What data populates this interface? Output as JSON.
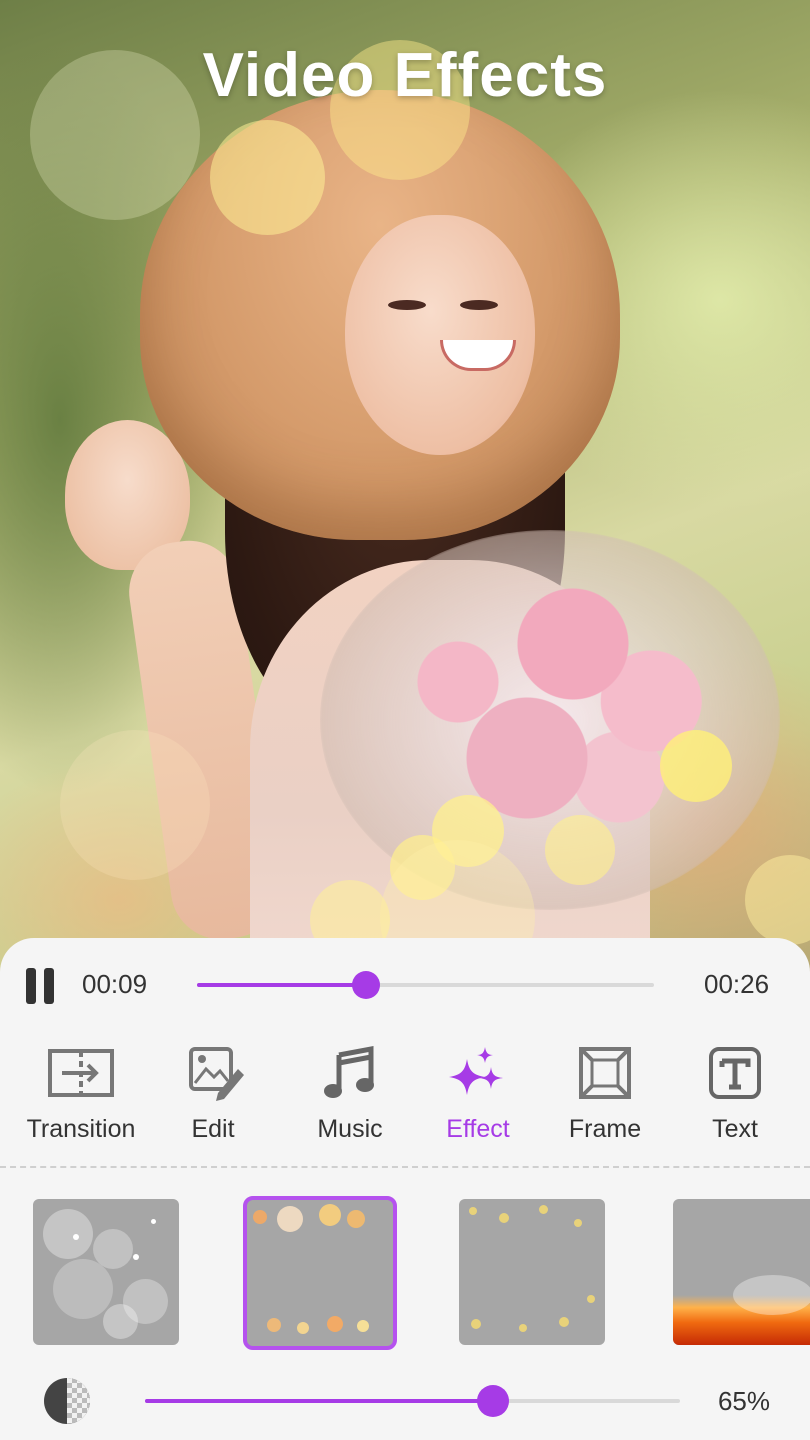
{
  "header": {
    "title": "Video Effects"
  },
  "player": {
    "current_time": "00:09",
    "total_time": "00:26",
    "progress": 0.37
  },
  "tools": [
    {
      "label": "Transition",
      "icon": "transition-icon",
      "active": false
    },
    {
      "label": "Edit",
      "icon": "edit-image-icon",
      "active": false
    },
    {
      "label": "Music",
      "icon": "music-note-icon",
      "active": false
    },
    {
      "label": "Effect",
      "icon": "sparkles-icon",
      "active": true
    },
    {
      "label": "Frame",
      "icon": "frame-icon",
      "active": false
    },
    {
      "label": "Text",
      "icon": "text-icon",
      "active": false
    }
  ],
  "effects": [
    {
      "name": "sparkle-bokeh",
      "selected": false
    },
    {
      "name": "golden-bokeh",
      "selected": true
    },
    {
      "name": "glitter-dust",
      "selected": false
    },
    {
      "name": "fire",
      "selected": false
    }
  ],
  "opacity": {
    "value": 0.65,
    "label": "65%",
    "icon": "opacity-icon"
  },
  "colors": {
    "accent": "#a63be6",
    "panel": "#f5f5f5",
    "text": "#333333"
  }
}
